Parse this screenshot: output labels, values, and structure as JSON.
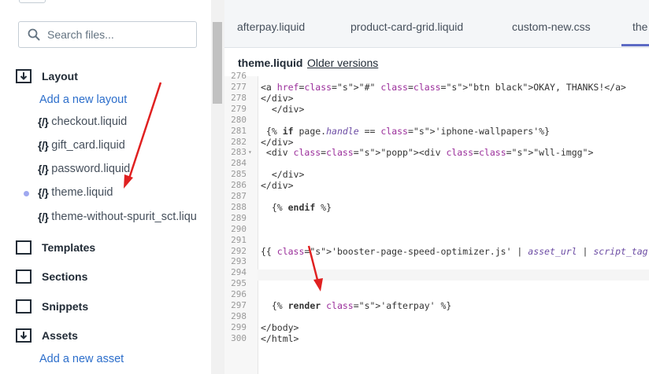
{
  "sidebar": {
    "search_placeholder": "Search files...",
    "folders": {
      "layout": "Layout",
      "templates": "Templates",
      "sections": "Sections",
      "snippets": "Snippets",
      "assets": "Assets"
    },
    "add_layout": "Add a new layout",
    "add_asset": "Add a new asset",
    "files": [
      {
        "icon": "{/}",
        "name": "checkout.liquid"
      },
      {
        "icon": "{/}",
        "name": "gift_card.liquid"
      },
      {
        "icon": "{/}",
        "name": "password.liquid"
      },
      {
        "icon": "{/}",
        "name": "theme.liquid"
      },
      {
        "icon": "{/}",
        "name": "theme-without-spurit_sct.liqu"
      }
    ]
  },
  "tabs": [
    "afterpay.liquid",
    "product-card-grid.liquid",
    "custom-new.css",
    "the"
  ],
  "file_header": {
    "name": "theme.liquid",
    "older_versions": "Older versions"
  },
  "code_lines": [
    {
      "num": "277",
      "text": "<a href=\"#\" class=\"btn black\">OKAY, THANKS!</a>"
    },
    {
      "num": "278",
      "text": "</div>"
    },
    {
      "num": "279",
      "text": "  </div>"
    },
    {
      "num": "280",
      "text": ""
    },
    {
      "num": "281",
      "text": " {% if page.handle == 'iphone-wallpapers'%}"
    },
    {
      "num": "282",
      "text": "</div>"
    },
    {
      "num": "283",
      "text": " <div class=\"popp\"><div class=\"wll-imgg\">"
    },
    {
      "num": "284",
      "text": ""
    },
    {
      "num": "285",
      "text": "  </div>"
    },
    {
      "num": "286",
      "text": "</div>"
    },
    {
      "num": "287",
      "text": ""
    },
    {
      "num": "288",
      "text": "  {% endif %}"
    },
    {
      "num": "289",
      "text": ""
    },
    {
      "num": "290",
      "text": ""
    },
    {
      "num": "291",
      "text": ""
    },
    {
      "num": "292",
      "text": "{{ 'booster-page-speed-optimizer.js' | asset_url | script_tag }}"
    },
    {
      "num": "293",
      "text": ""
    },
    {
      "num": "294",
      "text": ""
    },
    {
      "num": "295",
      "text": ""
    },
    {
      "num": "296",
      "text": ""
    },
    {
      "num": "297",
      "text": "  {% render 'afterpay' %}"
    },
    {
      "num": "298",
      "text": ""
    },
    {
      "num": "299",
      "text": "</body>"
    },
    {
      "num": "300",
      "text": "</html>"
    }
  ],
  "colors": {
    "link": "#2c6ecb",
    "arrow": "#e02020",
    "active_tab": "#5c6ac4"
  }
}
